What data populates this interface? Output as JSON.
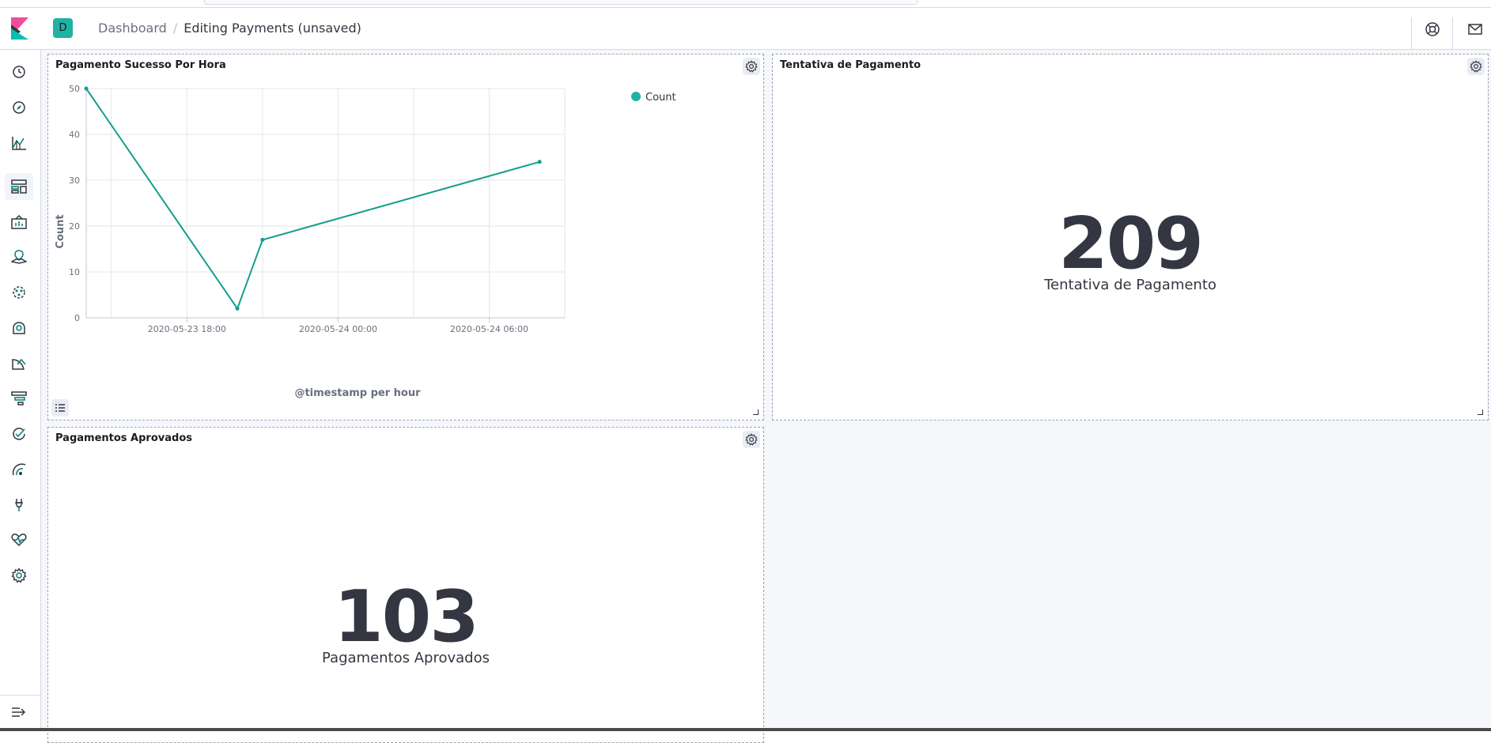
{
  "header": {
    "space_initial": "D",
    "breadcrumbs": {
      "parent": "Dashboard",
      "current": "Editing Payments (unsaved)"
    },
    "icons": [
      "help-icon",
      "mail-icon"
    ]
  },
  "sidenav": {
    "items": [
      "clock-icon",
      "compass-icon",
      "visualize-icon",
      "dashboard-icon",
      "canvas-icon",
      "maps-icon",
      "ml-icon",
      "infra-icon",
      "logs-icon",
      "apm-icon",
      "uptime-icon",
      "siem-icon",
      "devtools-icon",
      "monitoring-icon",
      "management-icon"
    ],
    "active": "dashboard-icon",
    "collapse_icon": "collapse-nav-icon"
  },
  "panels": {
    "line_chart": {
      "title": "Pagamento Sucesso Por Hora"
    },
    "attempts": {
      "title": "Tentativa de Pagamento",
      "value": "209",
      "label": "Tentativa de Pagamento"
    },
    "approved": {
      "title": "Pagamentos Aprovados",
      "value": "103",
      "label": "Pagamentos Aprovados"
    }
  },
  "colors": {
    "accent": "#20b2a2",
    "series": "#159d8d",
    "text": "#343741"
  },
  "chart_data": {
    "type": "line",
    "title": "Pagamento Sucesso Por Hora",
    "xlabel": "@timestamp per hour",
    "ylabel": "Count",
    "x": [
      "2020-05-23 14:00",
      "2020-05-23 20:00",
      "2020-05-23 21:00",
      "2020-05-24 08:00"
    ],
    "series": [
      {
        "name": "Count",
        "values": [
          50,
          2,
          17,
          34
        ]
      }
    ],
    "xlim": [
      "2020-05-23 14:00",
      "2020-05-24 09:00"
    ],
    "ylim": [
      0,
      50
    ],
    "yticks": [
      0,
      10,
      20,
      30,
      40,
      50
    ],
    "xticks": [
      "2020-05-23 18:00",
      "2020-05-24 00:00",
      "2020-05-24 06:00"
    ],
    "legend": "top-right",
    "grid": true
  }
}
